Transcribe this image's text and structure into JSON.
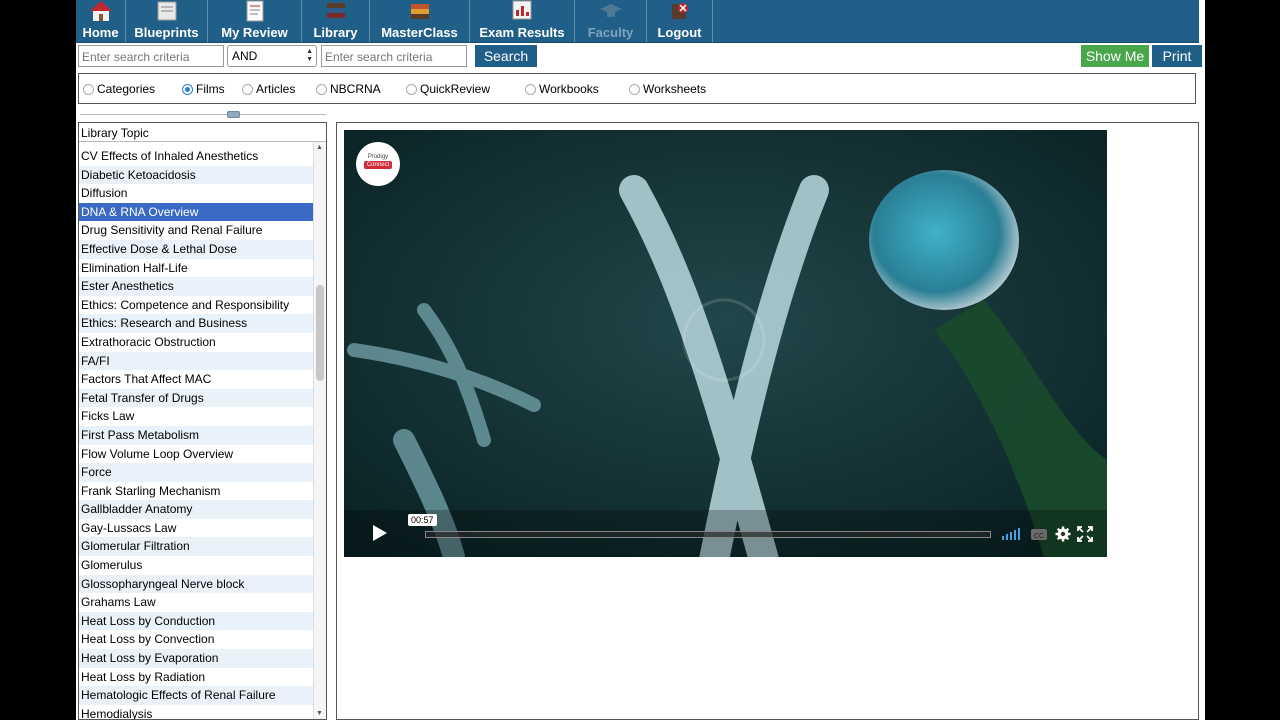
{
  "nav": {
    "items": [
      {
        "label": "Home",
        "icon": "home-icon"
      },
      {
        "label": "Blueprints",
        "icon": "blueprints-icon"
      },
      {
        "label": "My Review",
        "icon": "review-icon"
      },
      {
        "label": "Library",
        "icon": "books-icon"
      },
      {
        "label": "MasterClass",
        "icon": "masterclass-icon"
      },
      {
        "label": "Exam Results",
        "icon": "results-icon"
      },
      {
        "label": "Faculty",
        "icon": "faculty-icon"
      },
      {
        "label": "Logout",
        "icon": "logout-icon"
      }
    ]
  },
  "search": {
    "placeholder1": "Enter search criteria",
    "operator": "AND",
    "placeholder2": "Enter search criteria",
    "search_label": "Search",
    "show_me_label": "Show Me",
    "print_label": "Print"
  },
  "filters": {
    "options": [
      "Categories",
      "Films",
      "Articles",
      "NBCRNA",
      "QuickReview",
      "Workbooks",
      "Worksheets"
    ],
    "selected": "Films"
  },
  "topics": {
    "header": "Library Topic",
    "selected": "DNA & RNA Overview",
    "items": [
      "CV Effects of Inhaled Anesthetics",
      "Diabetic Ketoacidosis",
      "Diffusion",
      "DNA & RNA Overview",
      "Drug Sensitivity and Renal Failure",
      "Effective Dose & Lethal Dose",
      "Elimination Half-Life",
      "Ester Anesthetics",
      "Ethics: Competence and Responsibility",
      "Ethics: Research and Business",
      "Extrathoracic Obstruction",
      "FA/FI",
      "Factors That Affect MAC",
      "Fetal Transfer of Drugs",
      "Ficks Law",
      "First Pass Metabolism",
      "Flow Volume Loop Overview",
      "Force",
      "Frank Starling Mechanism",
      "Gallbladder Anatomy",
      "Gay-Lussacs Law",
      "Glomerular Filtration",
      "Glomerulus",
      "Glossopharyngeal Nerve block",
      "Grahams Law",
      "Heat Loss by Conduction",
      "Heat Loss by Convection",
      "Heat Loss by Evaporation",
      "Heat Loss by Radiation",
      "Hematologic Effects of Renal Failure",
      "Hemodialysis"
    ]
  },
  "video": {
    "logo_line1": "Prodigy",
    "logo_line2": "Connect",
    "timestamp": "00:57",
    "progress": 0.0
  },
  "colors": {
    "nav_bg": "#1f5f88",
    "selected_row": "#3a6bc4",
    "show_me": "#4aa64a"
  }
}
